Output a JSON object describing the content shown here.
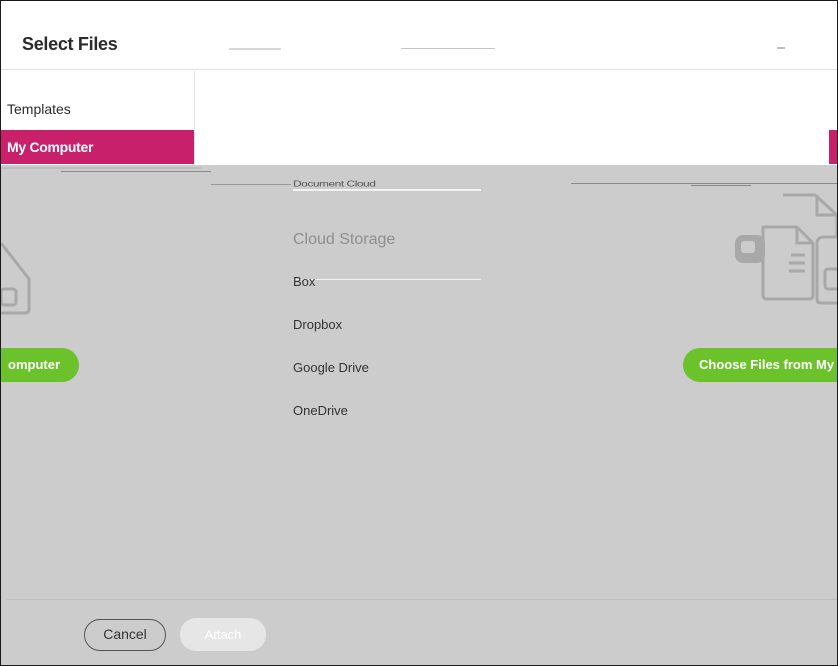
{
  "dialog": {
    "title": "Select Files"
  },
  "sidebar": {
    "items": [
      {
        "label": "Templates"
      },
      {
        "label": "My Computer"
      }
    ]
  },
  "storage_panel": {
    "document_cloud": "Document Cloud",
    "cloud_heading": "Cloud Storage",
    "providers": [
      "Box",
      "Dropbox",
      "Google Drive",
      "OneDrive"
    ]
  },
  "buttons": {
    "choose_left_label": "omputer",
    "choose_right_label": "Choose Files from My",
    "cancel": "Cancel",
    "attach": "Attach"
  },
  "colors": {
    "accent_pink": "#c9206c",
    "green": "#6cc22a",
    "overlay_gray": "#cccccc"
  },
  "icons": {
    "left": "file-stack-icon",
    "right": "file-stack-icon"
  }
}
